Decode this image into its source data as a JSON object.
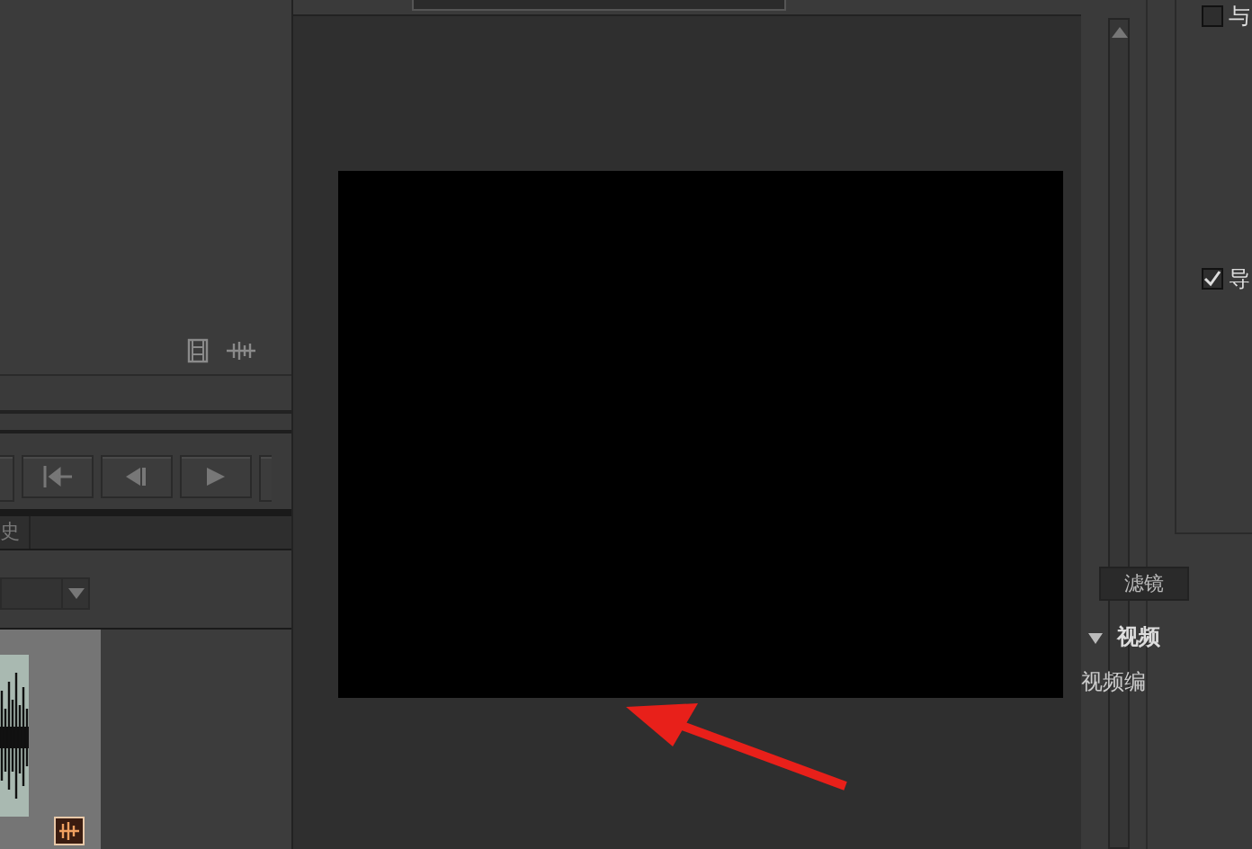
{
  "left_panel": {
    "history_tab": {
      "label": "史",
      "selected": false
    }
  },
  "right_panel": {
    "options": [
      {
        "label": "与",
        "checked": false
      },
      {
        "label": "导",
        "checked": true
      }
    ],
    "filter_tab": {
      "label": "滤镜",
      "selected": true
    },
    "video_section": {
      "title": "视频",
      "expanded": true,
      "label": "视频编"
    }
  },
  "annotation": {
    "kind": "arrow"
  }
}
